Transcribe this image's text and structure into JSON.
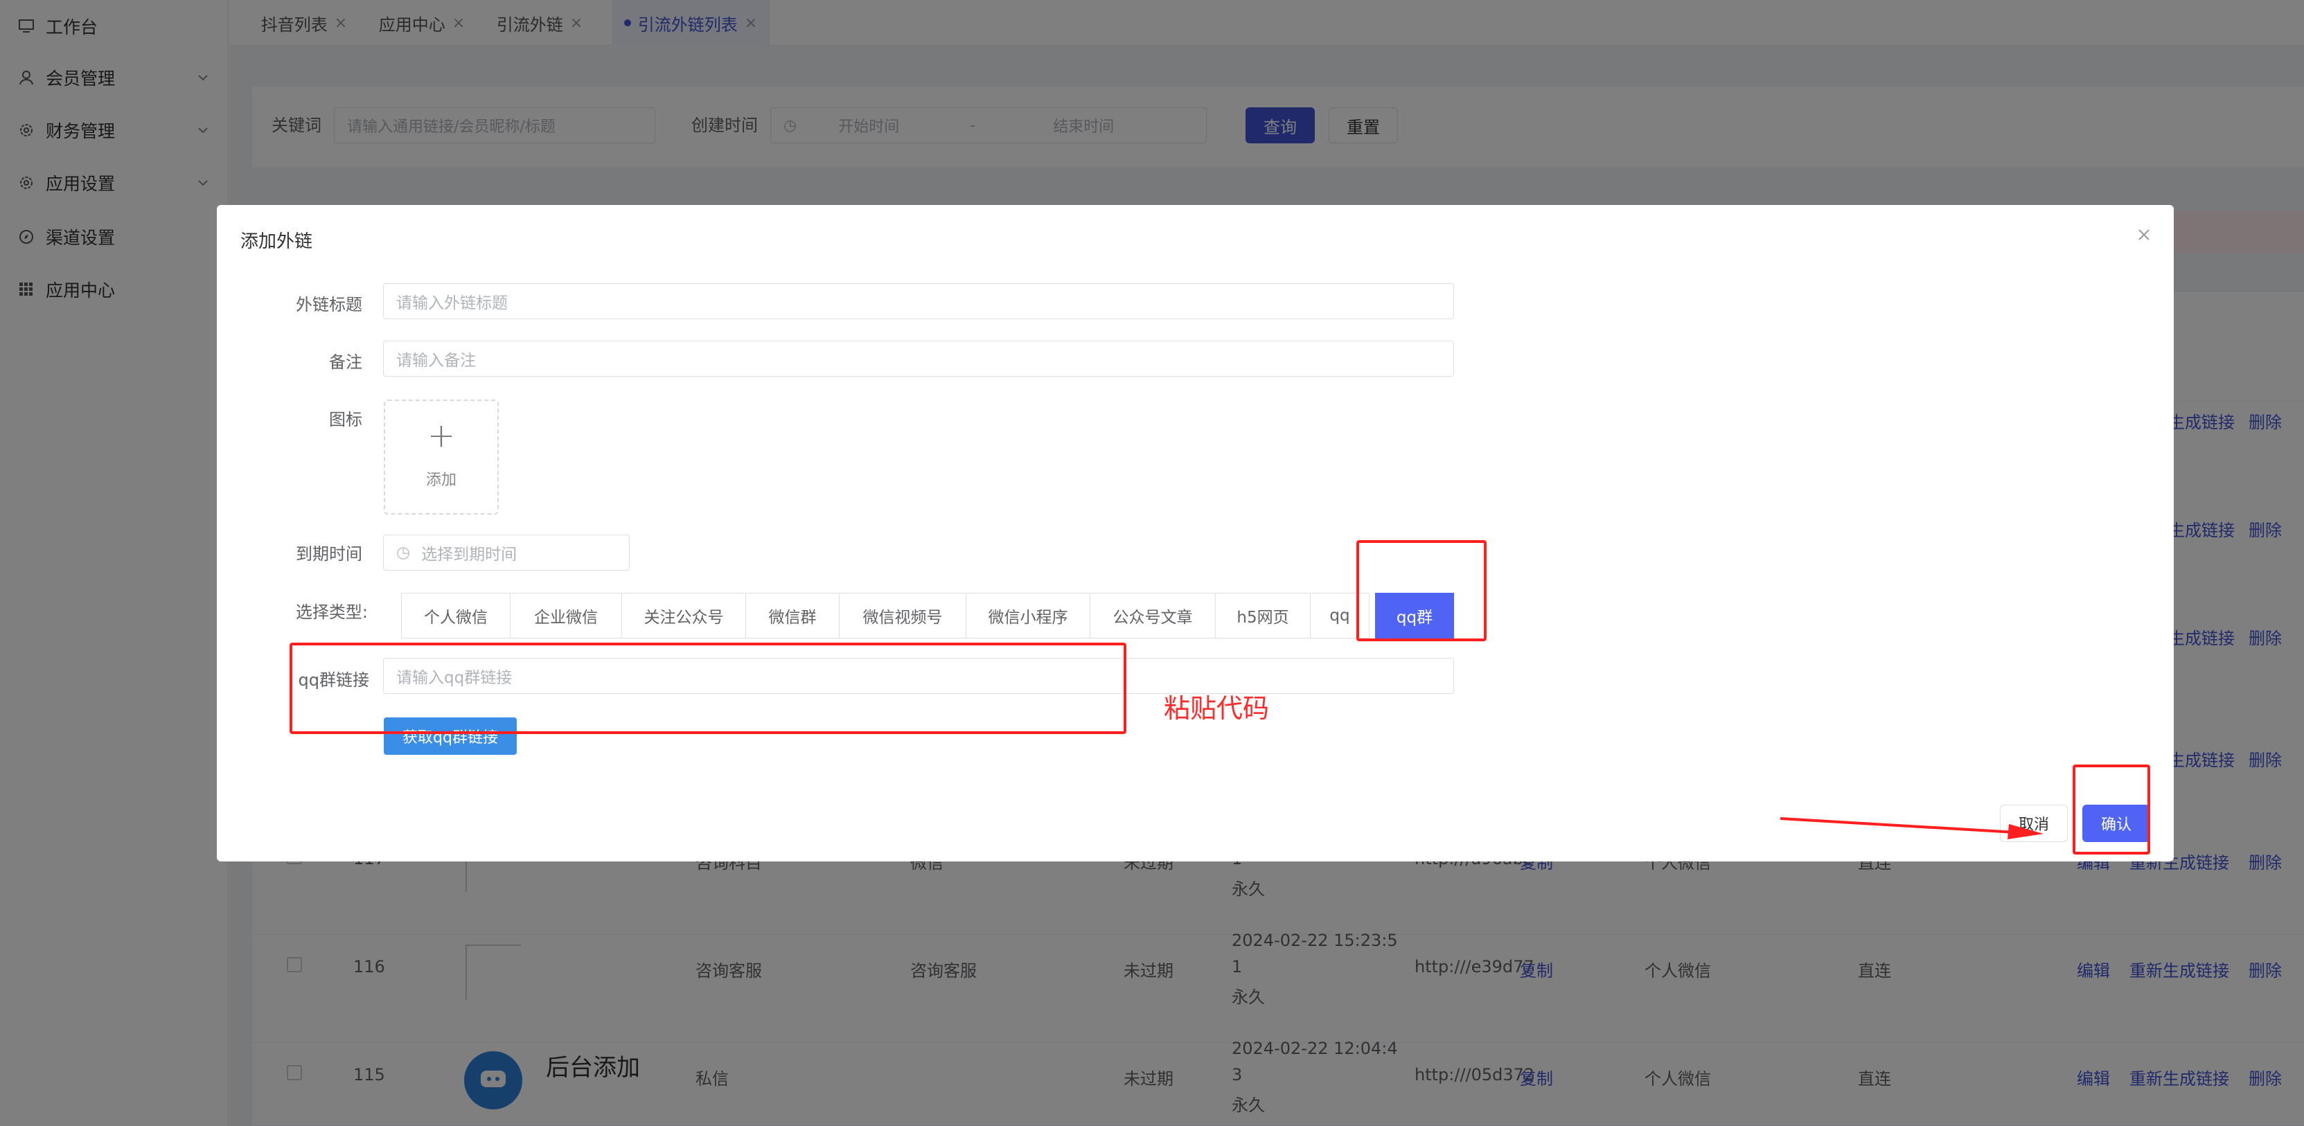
{
  "sidebar": {
    "items": [
      {
        "label": "工作台",
        "icon": "monitor-icon"
      },
      {
        "label": "会员管理",
        "icon": "user-icon"
      },
      {
        "label": "财务管理",
        "icon": "gear-icon"
      },
      {
        "label": "应用设置",
        "icon": "gear-icon"
      },
      {
        "label": "渠道设置",
        "icon": "compass-icon"
      },
      {
        "label": "应用中心",
        "icon": "grid-icon"
      }
    ]
  },
  "tabs": [
    {
      "label": "抖音列表",
      "close": "×"
    },
    {
      "label": "应用中心",
      "close": "×"
    },
    {
      "label": "引流外链",
      "close": "×"
    },
    {
      "label": "引流外链列表",
      "close": "×"
    }
  ],
  "search": {
    "keyword_label": "关键词",
    "keyword_placeholder": "请输入通用链接/会员昵称/标题",
    "date_label": "创建时间",
    "start_placeholder": "开始时间",
    "date_sep": "-",
    "end_placeholder": "结束时间",
    "query_button": "查询",
    "reset_button": "重置"
  },
  "table": {
    "rows": [
      {
        "id": "117",
        "title": "咨询科目",
        "name": "微信",
        "status": "未过期",
        "time_line1": "1",
        "time_line2": "永久",
        "url": "http:///a96abc",
        "copy": "复制",
        "type": "个人微信",
        "mode": "直连"
      },
      {
        "id": "116",
        "title": "咨询客服",
        "name": "咨询客服",
        "status": "未过期",
        "time_line0": "2024-02-22 15:23:5",
        "time_line1": "1",
        "time_line2": "永久",
        "url": "http:///e39d77",
        "copy": "复制",
        "type": "个人微信",
        "mode": "直连"
      },
      {
        "id": "115",
        "avatar_text": "后台添加",
        "title": "私信",
        "status": "未过期",
        "time_line0": "2024-02-22 12:04:4",
        "time_line1": "3",
        "time_line2": "永久",
        "url": "http:///05d372",
        "copy": "复制",
        "type": "个人微信",
        "mode": "直连"
      }
    ],
    "actions": {
      "edit": "编辑",
      "regen": "重新生成链接",
      "delete": "删除"
    },
    "partial_regen": "生成链接",
    "partial_delete": "删除"
  },
  "modal": {
    "title": "添加外链",
    "close": "×",
    "title_label": "外链标题",
    "title_placeholder": "请输入外链标题",
    "remark_label": "备注",
    "remark_placeholder": "请输入备注",
    "icon_label": "图标",
    "upload_plus": "+",
    "upload_text": "添加",
    "expire_label": "到期时间",
    "expire_placeholder": "选择到期时间",
    "type_label": "选择类型:",
    "types": [
      "个人微信",
      "企业微信",
      "关注公众号",
      "微信群",
      "微信视频号",
      "微信小程序",
      "公众号文章",
      "h5网页",
      "qq",
      "qq群"
    ],
    "selected_type": "qq群",
    "qq_label": "qq群链接",
    "qq_placeholder": "请输入qq群链接",
    "get_link_button": "获取qq群链接",
    "cancel_button": "取消",
    "confirm_button": "确认"
  },
  "annotation": {
    "paste_text": "粘贴代码"
  },
  "colors": {
    "primary": "#4054d6",
    "selected_type": "#4f63f5",
    "blue_button": "#3a8ee6",
    "annotation_red": "#ff1f1f"
  }
}
